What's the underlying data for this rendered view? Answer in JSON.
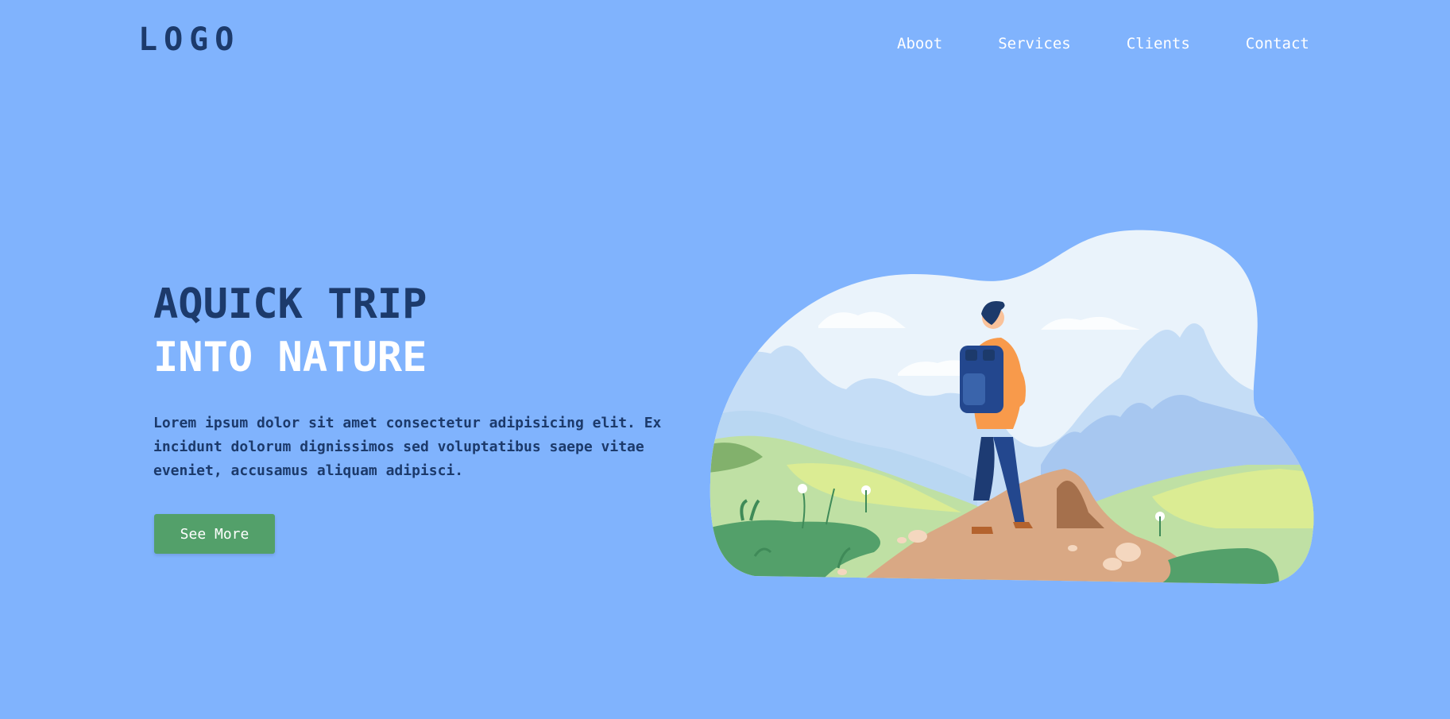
{
  "header": {
    "logo": "LOGO",
    "nav": [
      "Aboot",
      "Services",
      "Clients",
      "Contact"
    ]
  },
  "hero": {
    "title_line1": "AQUICK TRIP",
    "title_line2": "INTO NATURE",
    "body": "Lorem ipsum dolor sit amet consectetur adipisicing elit. Ex incidunt dolorum dignissimos sed voluptatibus saepe vitae eveniet, accusamus aliquam adipisci.",
    "button_label": "See More"
  },
  "colors": {
    "background": "#80b3fd",
    "dark_blue": "#1c3a6b",
    "button_green": "#53a06a",
    "text_white": "#ffffff"
  }
}
